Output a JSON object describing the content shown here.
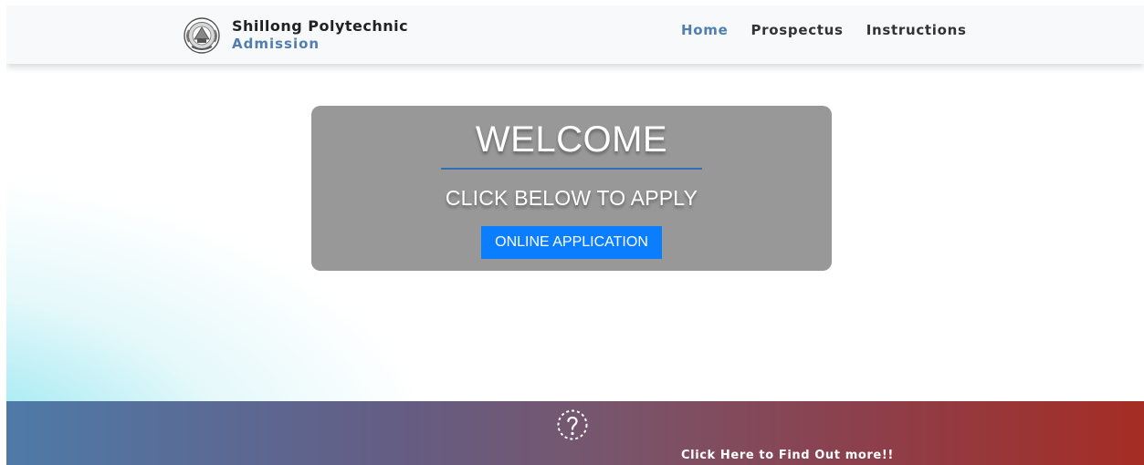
{
  "brand": {
    "title": "Shillong Polytechnic",
    "subtitle": "Admission",
    "logo_icon": "college-seal-logo"
  },
  "nav": {
    "items": [
      {
        "label": "Home",
        "active": true
      },
      {
        "label": "Prospectus",
        "active": false
      },
      {
        "label": "Instructions",
        "active": false
      }
    ]
  },
  "hero": {
    "title": "WELCOME",
    "subtitle": "CLICK BELOW TO APPLY",
    "button_label": "ONLINE APPLICATION"
  },
  "footer_banner": {
    "icon": "question-mark-icon",
    "link_text": "Click Here to Find Out more!!"
  },
  "colors": {
    "brand_blue": "#4f7eaf",
    "panel_gray": "#989898",
    "button_blue": "#0a7eff",
    "banner_start": "#4f7aa8",
    "banner_end": "#a52d24",
    "hero_glow": "#79e7ef"
  }
}
